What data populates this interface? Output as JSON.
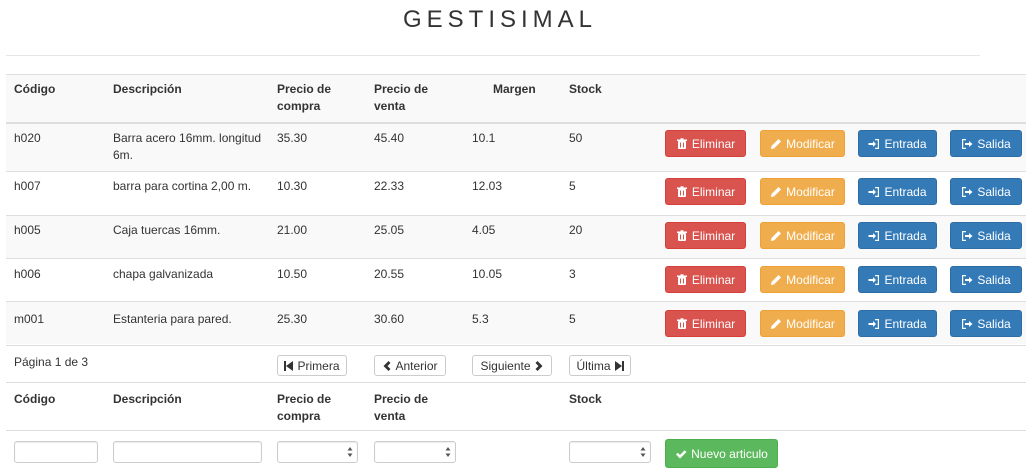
{
  "app": {
    "title": "GESTISIMAL"
  },
  "table": {
    "headers": {
      "code": "Código",
      "description": "Descripción",
      "purchase_price_1": "Precio de",
      "purchase_price_2": "compra",
      "sale_price_1": "Precio de",
      "sale_price_2": "venta",
      "margin": "Margen",
      "stock": "Stock"
    },
    "rows": [
      {
        "code": "h020",
        "description_1": "Barra acero 16mm. longitud",
        "description_2": "6m.",
        "purchase_price": "35.30",
        "sale_price": "45.40",
        "margin": "10.1",
        "stock": "50"
      },
      {
        "code": "h007",
        "description_1": "barra para cortina 2,00 m.",
        "description_2": "",
        "purchase_price": "10.30",
        "sale_price": "22.33",
        "margin": "12.03",
        "stock": "5"
      },
      {
        "code": "h005",
        "description_1": "Caja tuercas 16mm.",
        "description_2": "",
        "purchase_price": "21.00",
        "sale_price": "25.05",
        "margin": "4.05",
        "stock": "20"
      },
      {
        "code": "h006",
        "description_1": "chapa galvanizada",
        "description_2": "",
        "purchase_price": "10.50",
        "sale_price": "20.55",
        "margin": "10.05",
        "stock": "3"
      },
      {
        "code": "m001",
        "description_1": "Estanteria para pared.",
        "description_2": "",
        "purchase_price": "25.30",
        "sale_price": "30.60",
        "margin": "5.3",
        "stock": "5"
      }
    ],
    "actions": {
      "delete": "Eliminar",
      "modify": "Modificar",
      "entry": "Entrada",
      "exit": "Salida"
    }
  },
  "pagination": {
    "page_info": "Página 1 de 3",
    "first": "Primera",
    "previous": "Anterior",
    "next": "Siguiente",
    "last": "Última"
  },
  "new_form": {
    "headers": {
      "code": "Código",
      "description": "Descripción",
      "purchase_price_1": "Precio de",
      "purchase_price_2": "compra",
      "sale_price_1": "Precio de",
      "sale_price_2": "venta",
      "stock": "Stock"
    },
    "fields": {
      "code": "",
      "description": "",
      "purchase_price": "",
      "sale_price": "",
      "stock": ""
    },
    "submit": "Nuevo articulo"
  },
  "icons": {
    "delete": "trash-icon",
    "modify": "pencil-icon",
    "entry": "log-in-icon",
    "exit": "log-out-icon",
    "first": "step-backward-icon",
    "previous": "chevron-left-icon",
    "next": "chevron-right-icon",
    "last": "step-forward-icon",
    "submit": "ok-icon"
  },
  "colors": {
    "danger": "#d9534f",
    "warning": "#f0ad4e",
    "primary": "#337ab7",
    "success": "#5cb85c",
    "stripe": "#f9f9f9"
  }
}
